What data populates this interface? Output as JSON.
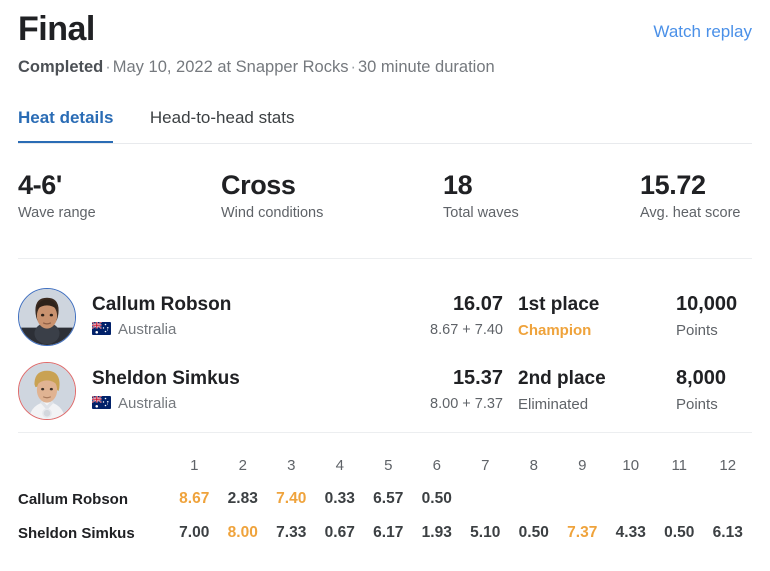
{
  "header": {
    "title": "Final",
    "status": "Completed",
    "meta": "May 10, 2022 at Snapper Rocks",
    "duration": "30 minute duration",
    "separator": "·",
    "watch_replay_label": "Watch replay",
    "link_color": "#4a90e8"
  },
  "tabs": [
    {
      "label": "Heat details",
      "active": true
    },
    {
      "label": "Head-to-head stats",
      "active": false
    }
  ],
  "tab_accent_color": "#2a6cb5",
  "stats": [
    {
      "value": "4-6'",
      "label": "Wave range"
    },
    {
      "value": "Cross",
      "label": "Wind conditions"
    },
    {
      "value": "18",
      "label": "Total waves"
    },
    {
      "value": "15.72",
      "label": "Avg. heat score"
    }
  ],
  "athletes": [
    {
      "name": "Callum Robson",
      "country": "Australia",
      "flag": "australia-flag",
      "heat_score": "16.07",
      "wave_breakdown": "8.67 + 7.40",
      "place": "1st place",
      "status": "Champion",
      "status_type": "champion",
      "points": "10,000",
      "points_label": "Points",
      "avatar_ring_color": "#3f6fc0"
    },
    {
      "name": "Sheldon Simkus",
      "country": "Australia",
      "flag": "australia-flag",
      "heat_score": "15.37",
      "wave_breakdown": "8.00 + 7.37",
      "place": "2nd place",
      "status": "Eliminated",
      "status_type": "eliminated",
      "points": "8,000",
      "points_label": "Points",
      "avatar_ring_color": "#e06a6a"
    }
  ],
  "wave_table": {
    "name_header": "",
    "columns": [
      "1",
      "2",
      "3",
      "4",
      "5",
      "6",
      "7",
      "8",
      "9",
      "10",
      "11",
      "12"
    ],
    "highlight_color": "#efa33c",
    "rows": [
      {
        "name": "Callum Robson",
        "scores": [
          "8.67",
          "2.83",
          "7.40",
          "0.33",
          "6.57",
          "0.50",
          "",
          "",
          "",
          "",
          "",
          ""
        ],
        "highlight_indices": [
          0,
          2
        ]
      },
      {
        "name": "Sheldon Simkus",
        "scores": [
          "7.00",
          "8.00",
          "7.33",
          "0.67",
          "6.17",
          "1.93",
          "5.10",
          "0.50",
          "7.37",
          "4.33",
          "0.50",
          "6.13"
        ],
        "highlight_indices": [
          1,
          8
        ]
      }
    ]
  }
}
